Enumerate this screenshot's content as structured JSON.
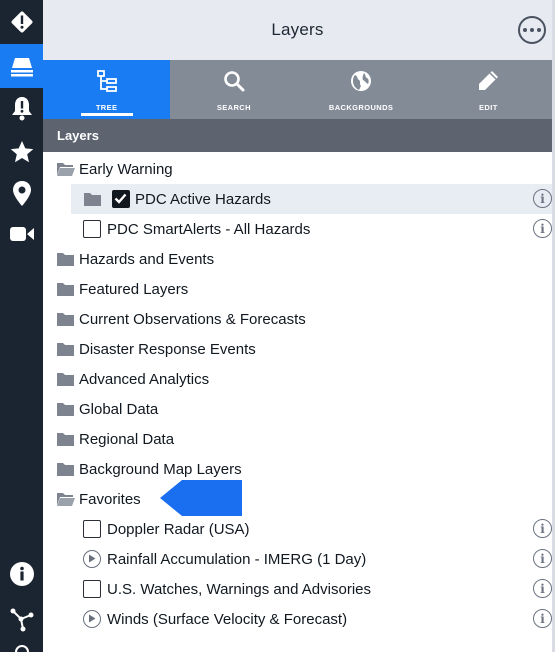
{
  "rail": {
    "items": [
      {
        "id": "alert-diamond",
        "icon": "alert-diamond-icon",
        "active": false
      },
      {
        "id": "layers",
        "icon": "layers-icon",
        "active": true
      },
      {
        "id": "alerts",
        "icon": "alert-bell-icon",
        "active": false
      },
      {
        "id": "favorites",
        "icon": "star-icon",
        "active": false
      },
      {
        "id": "location",
        "icon": "location-pin-icon",
        "active": false
      },
      {
        "id": "video",
        "icon": "video-camera-icon",
        "active": false
      },
      {
        "id": "info",
        "icon": "info-icon",
        "active": false
      },
      {
        "id": "measure",
        "icon": "measure-tool-icon",
        "active": false
      }
    ]
  },
  "header": {
    "title": "Layers",
    "more_icon": "more-options-icon"
  },
  "tabs": [
    {
      "label": "TREE",
      "icon": "tree-icon",
      "active": true
    },
    {
      "label": "SEARCH",
      "icon": "search-icon",
      "active": false
    },
    {
      "label": "BACKGROUNDS",
      "icon": "globe-icon",
      "active": false
    },
    {
      "label": "EDIT",
      "icon": "pencil-icon",
      "active": false
    }
  ],
  "section": {
    "title": "Layers"
  },
  "tree": {
    "early_warning": "Early Warning",
    "pdc_active_hazards": "PDC Active Hazards",
    "pdc_smartalerts": "PDC SmartAlerts - All Hazards",
    "hazards_events": "Hazards and Events",
    "featured_layers": "Featured Layers",
    "current_observations": "Current Observations & Forecasts",
    "disaster_response": "Disaster Response Events",
    "advanced_analytics": "Advanced Analytics",
    "global_data": "Global Data",
    "regional_data": "Regional Data",
    "background_map_layers": "Background Map Layers",
    "favorites": "Favorites",
    "doppler_radar": "Doppler Radar (USA)",
    "rainfall_accumulation": "Rainfall Accumulation - IMERG (1 Day)",
    "us_watches": "U.S. Watches, Warnings and Advisories",
    "winds": "Winds (Surface Velocity & Forecast)"
  },
  "state": {
    "pdc_active_hazards_checked": true,
    "pdc_smartalerts_checked": false,
    "doppler_radar_checked": false,
    "us_watches_checked": false
  },
  "colors": {
    "rail": "#1b2431",
    "accent": "#1a7cf2",
    "tabs_bg": "#838b97",
    "section_bar": "#5d6470",
    "header_bg": "#e7ebf1",
    "selected_row": "#e8ecf3"
  }
}
